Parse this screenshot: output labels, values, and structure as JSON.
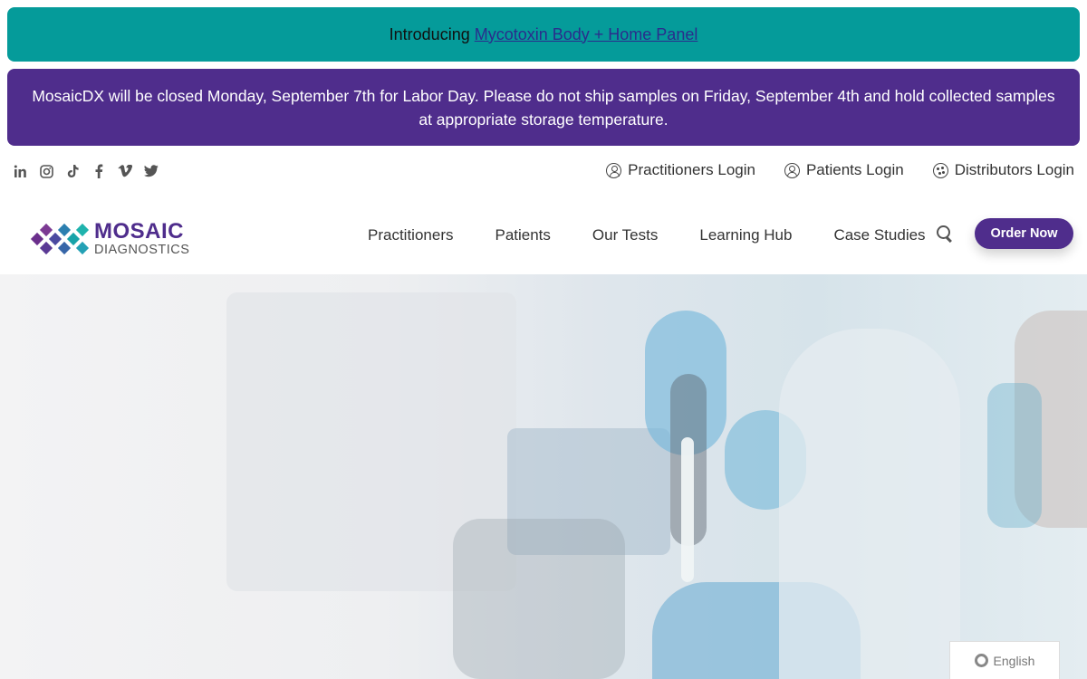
{
  "announcement": {
    "prefix": "Introducing",
    "link_text": "Mycotoxin Body + Home Panel"
  },
  "notice": {
    "text": "MosaicDX will be closed Monday, September 7th for Labor Day. Please do not ship samples on Friday, September 4th and hold collected samples at appropriate storage temperature."
  },
  "social": [
    "linkedin-icon",
    "instagram-icon",
    "tiktok-icon",
    "facebook-icon",
    "vimeo-icon",
    "twitter-icon"
  ],
  "logins": {
    "practitioners": "Practitioners Login",
    "patients": "Patients Login",
    "distributors": "Distributors Login"
  },
  "logo": {
    "line1": "MOSAIC",
    "line2": "DIAGNOSTICS"
  },
  "nav": {
    "items": [
      "Practitioners",
      "Patients",
      "Our Tests",
      "Learning Hub",
      "Case Studies"
    ]
  },
  "order_button": "Order Now",
  "language": "English",
  "colors": {
    "teal": "#059b9a",
    "purple": "#4f2d8c"
  }
}
